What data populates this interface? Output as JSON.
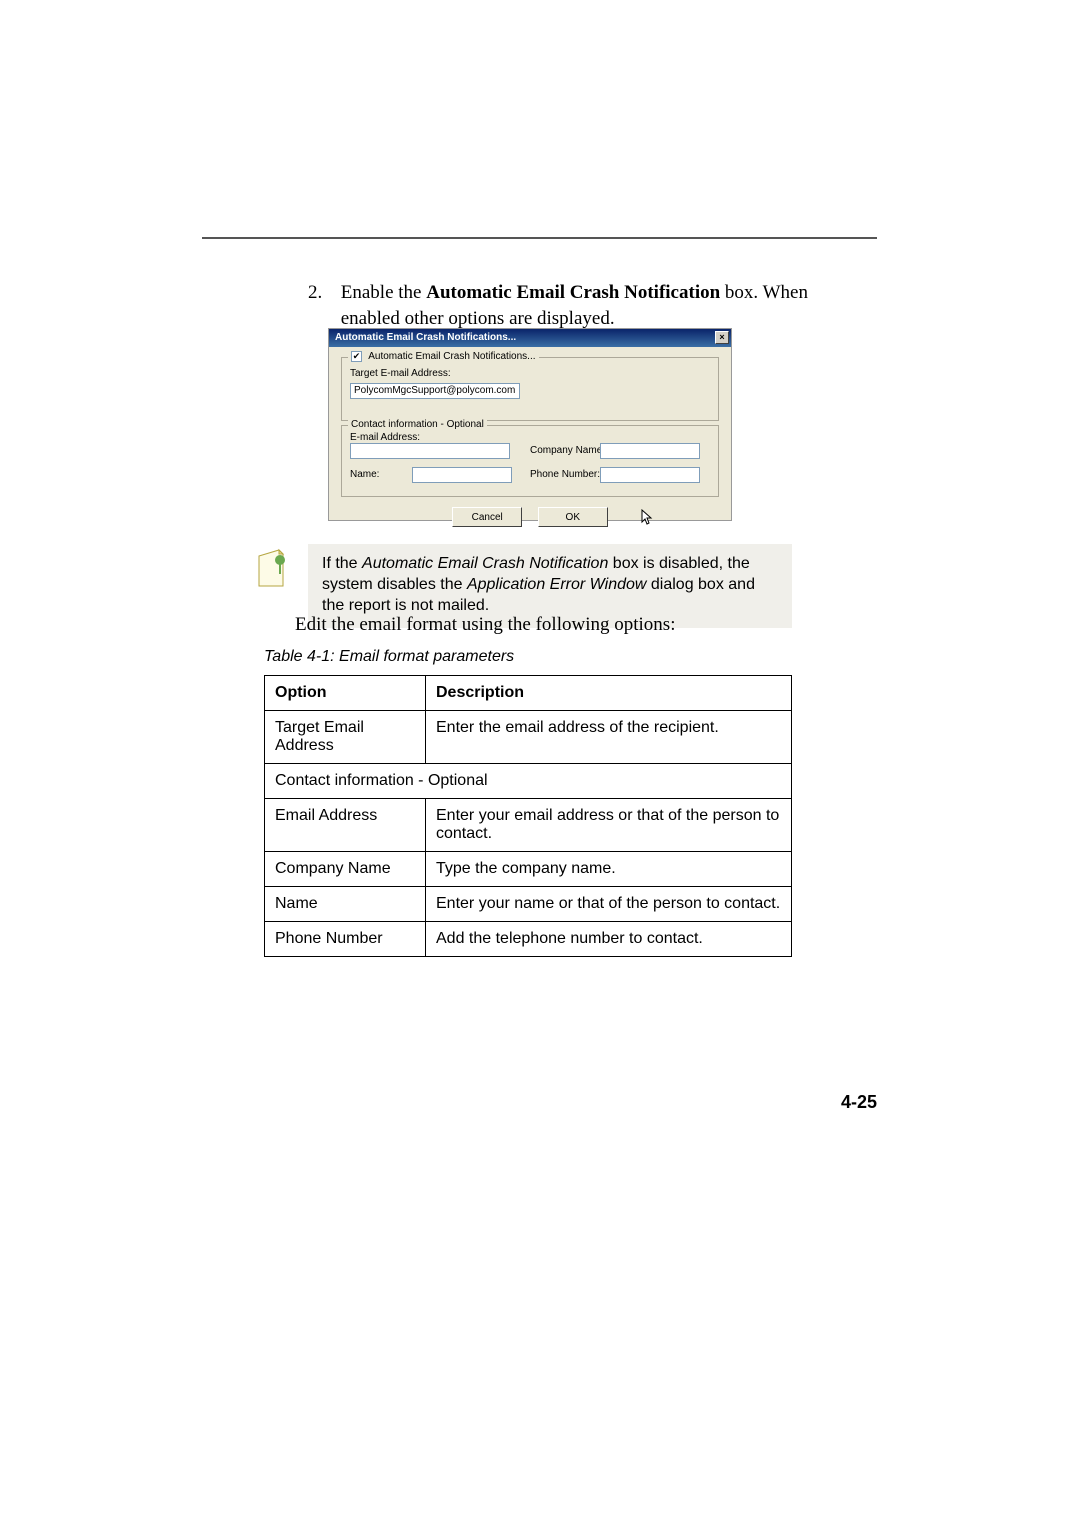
{
  "step": {
    "number": "2.",
    "text_a": "Enable the ",
    "text_bold": "Automatic Email Crash Notification",
    "text_b": " box. When enabled other options are displayed."
  },
  "dialog": {
    "title": "Automatic Email Crash  Notifications...",
    "close_glyph": "×",
    "checkbox_checked": "✔",
    "checkbox_label": "Automatic Email Crash  Notifications...",
    "target_label": "Target E-mail Address:",
    "target_value": "PolycomMgcSupport@polycom.com",
    "group2_legend": "Contact information - Optional",
    "email_label": "E-mail Address:",
    "company_label": "Company Name:",
    "name_label": "Name:",
    "phone_label": "Phone Number:",
    "btn_cancel": "Cancel",
    "btn_ok": "OK"
  },
  "note": {
    "part1": "If the ",
    "ital1": "Automatic Email Crash Notification",
    "part2": " box is disabled, the system disables the ",
    "ital2": "Application Error Window",
    "part3": " dialog box and the report is not mailed."
  },
  "edit_line": "Edit the email format using the following options:",
  "table_caption": "Table 4-1: Email format parameters",
  "table": {
    "head_option": "Option",
    "head_desc": "Description",
    "rows": [
      {
        "opt": "Target Email Address",
        "desc": "Enter the email address of the recipient."
      }
    ],
    "section_header": "Contact information - Optional",
    "rows2": [
      {
        "opt": "Email Address",
        "desc": "Enter your email address or that of the person to contact."
      },
      {
        "opt": "Company Name",
        "desc": "Type the company name."
      },
      {
        "opt": "Name",
        "desc": "Enter your name or that of the person to contact."
      },
      {
        "opt": "Phone Number",
        "desc": "Add the telephone number to contact."
      }
    ]
  },
  "page_number": "4-25"
}
